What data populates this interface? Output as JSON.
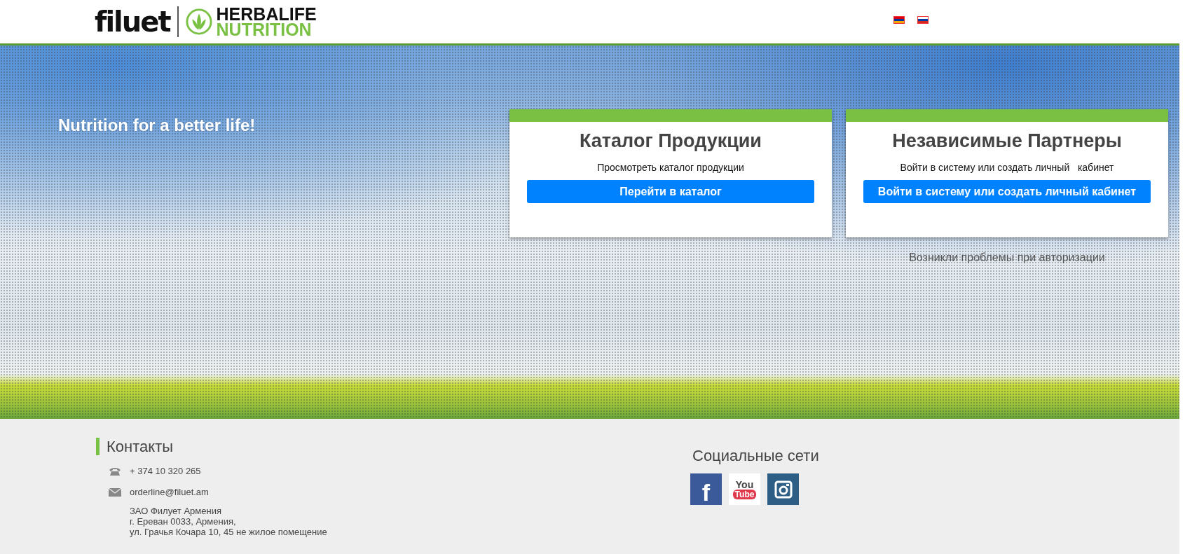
{
  "header": {
    "logo": {
      "brand": "filuet",
      "partner_top": "HERBALIFE",
      "partner_bottom": "NUTRITION"
    },
    "languages": [
      {
        "kind": "armenia"
      },
      {
        "kind": "russia"
      }
    ]
  },
  "hero": {
    "tagline": "Nutrition for a better life!",
    "cards": [
      {
        "title": "Каталог Продукции",
        "text": "Просмотреть каталог продукции",
        "button": "Перейти в каталог"
      },
      {
        "title": "Независимые Партнеры",
        "text": "Войти в систему или создать личный   кабинет",
        "button": "Войти в систему или создать личный кабинет",
        "link": "Возникли проблемы при авторизации"
      }
    ]
  },
  "footer": {
    "contacts": {
      "title": "Контакты",
      "phone": "+ 374 10 320 265",
      "email": "orderline@filuet.am",
      "address": [
        "ЗАО Филует Армения",
        "г. Ереван 0033, Армения,",
        "ул. Грачья Кочара 10, 45 не жилое помещение"
      ]
    },
    "social": {
      "title": "Социальные сети",
      "items": [
        {
          "kind": "facebook",
          "text": [
            "f"
          ]
        },
        {
          "kind": "youtube",
          "text": [
            "You",
            "Tube"
          ]
        },
        {
          "kind": "instagram"
        }
      ]
    }
  }
}
